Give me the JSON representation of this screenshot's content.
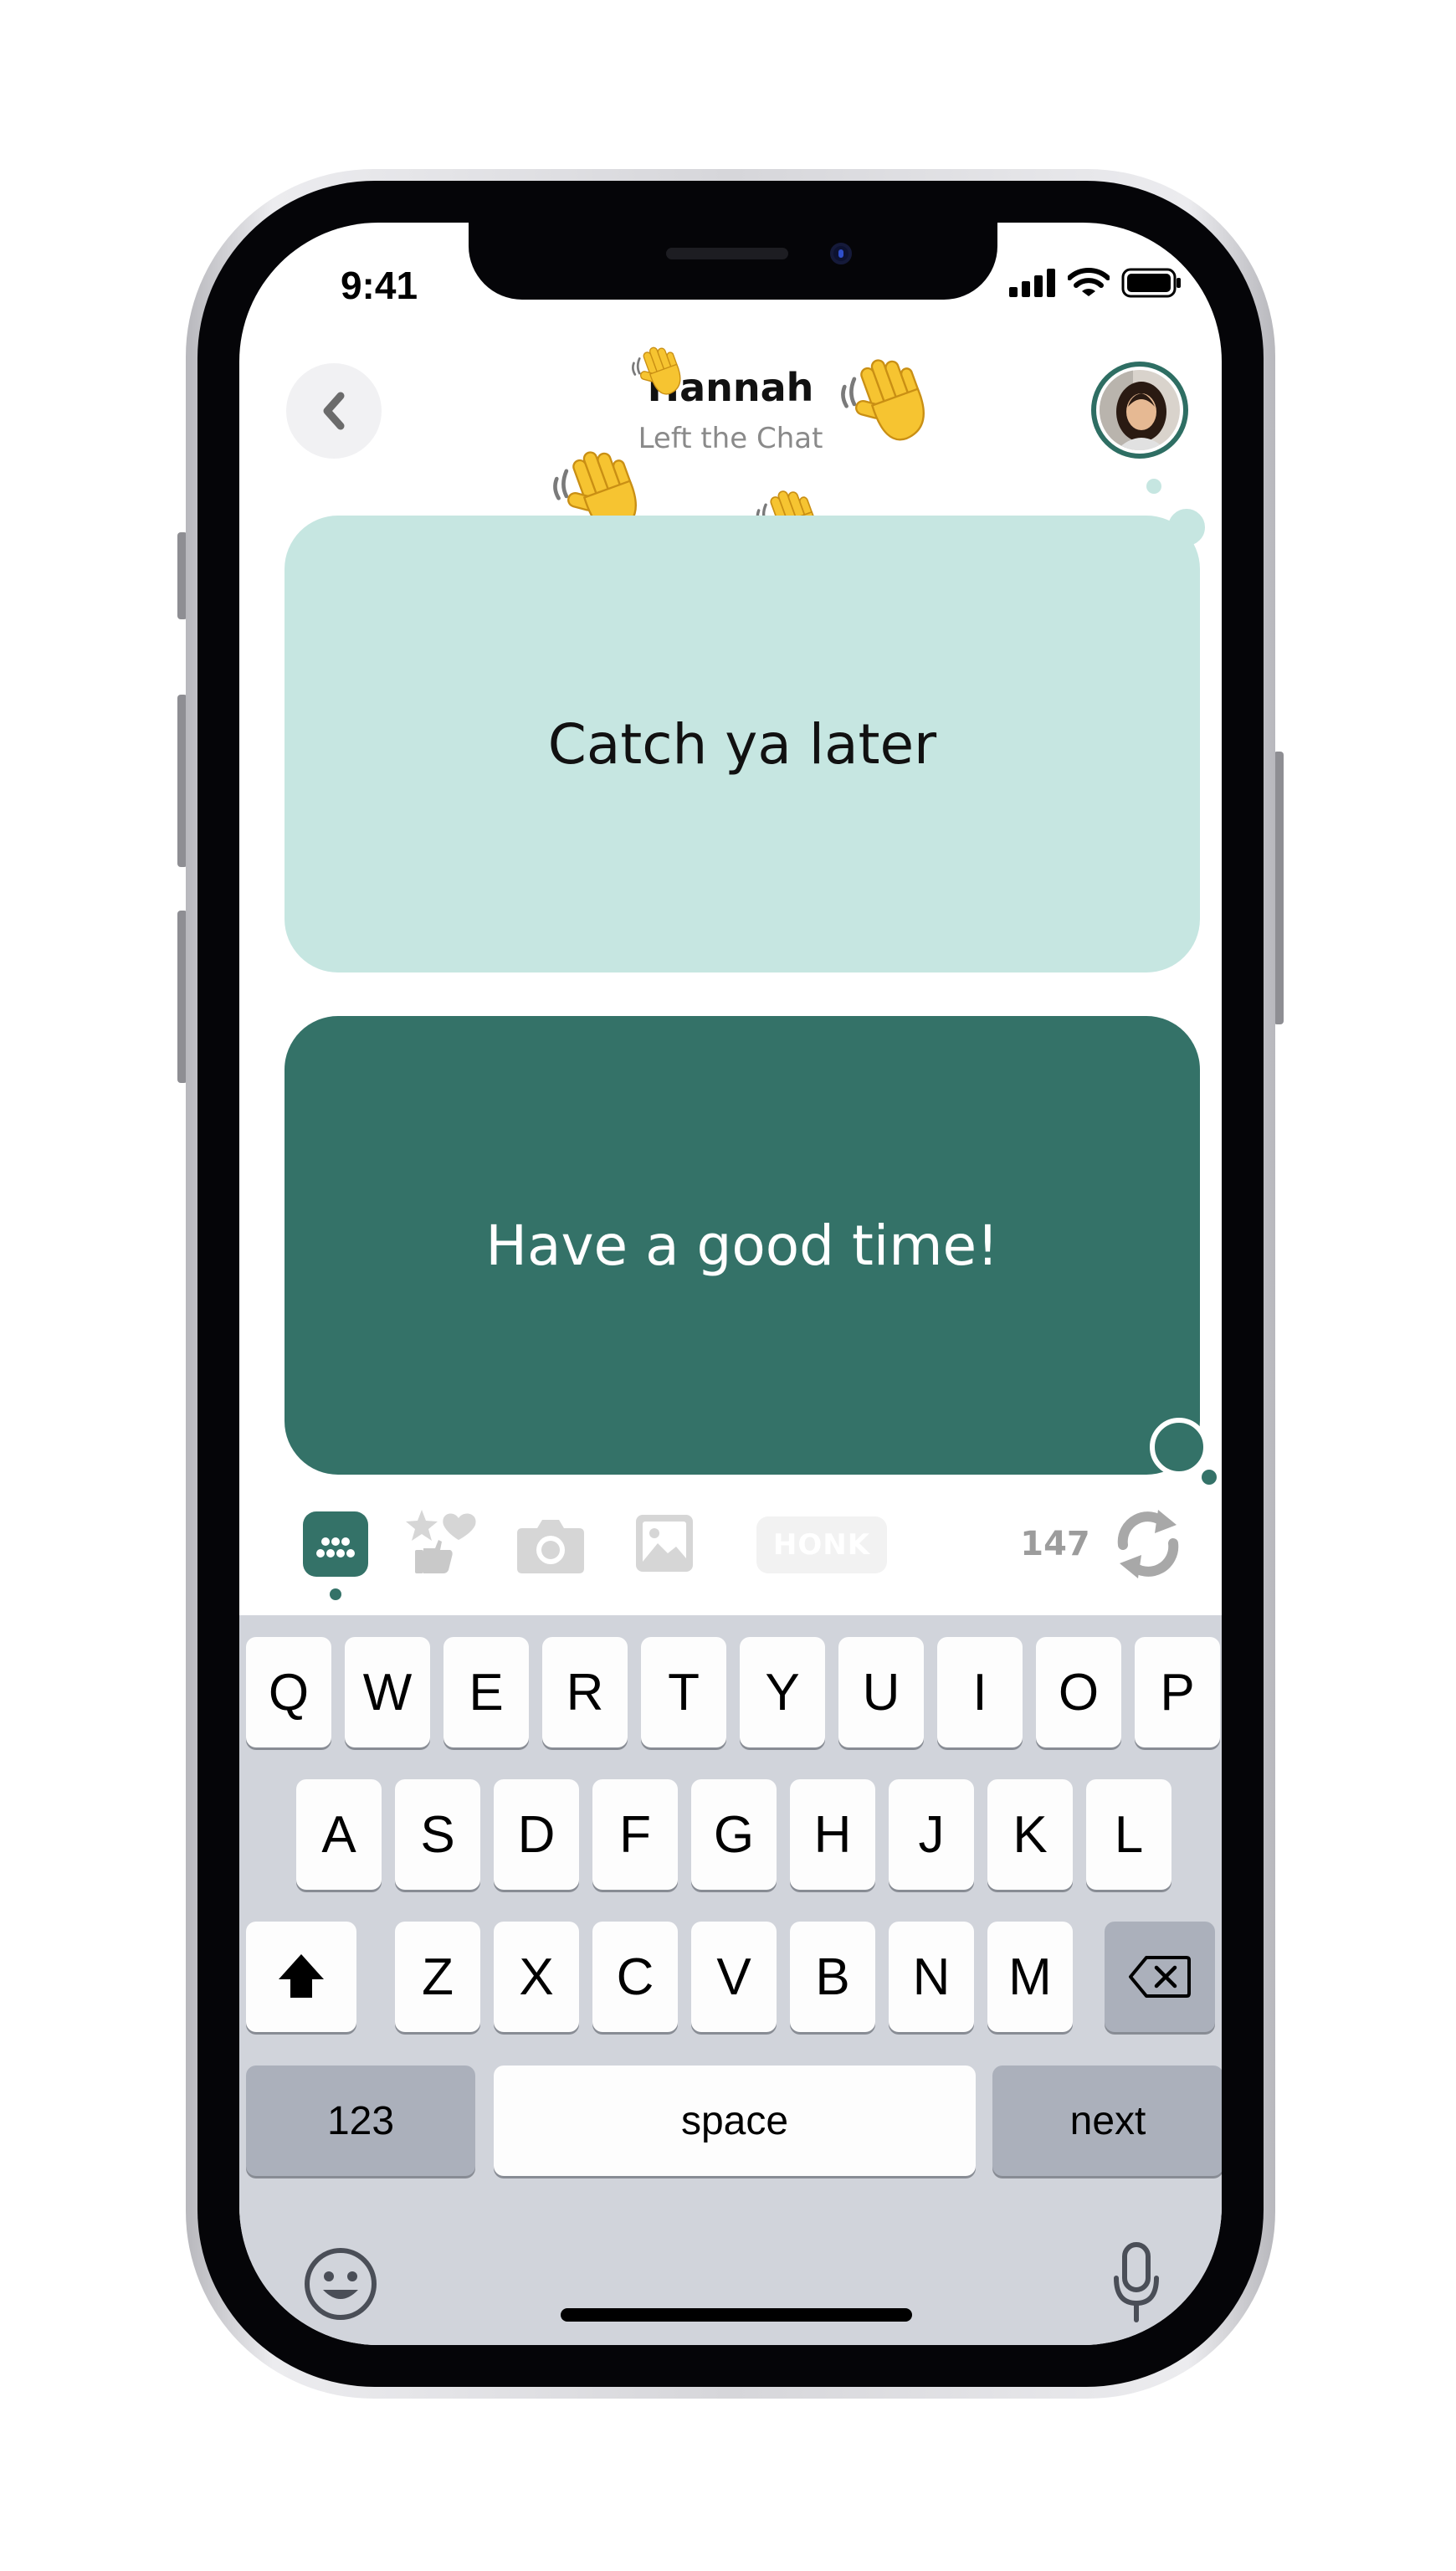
{
  "status_bar": {
    "time": "9:41"
  },
  "header": {
    "back_icon": "chevron-left-icon",
    "contact_name": "Hannah",
    "contact_status": "Left the Chat",
    "avatar_icon": "profile-photo"
  },
  "messages": [
    {
      "direction": "received",
      "text": "Catch ya later",
      "color": "#c6e6e1"
    },
    {
      "direction": "sent",
      "text": "Have a good time!",
      "color": "#347268"
    }
  ],
  "composer": {
    "tools": [
      "keyboard-icon",
      "stickers-icon",
      "camera-icon",
      "photo-icon"
    ],
    "honk_label": "HONK",
    "char_count": "147",
    "refresh_icon": "refresh-icon",
    "accent_color": "#347268"
  },
  "keyboard": {
    "row1": [
      "Q",
      "W",
      "E",
      "R",
      "T",
      "Y",
      "U",
      "I",
      "O",
      "P"
    ],
    "row2": [
      "A",
      "S",
      "D",
      "F",
      "G",
      "H",
      "J",
      "K",
      "L"
    ],
    "row3": [
      "Z",
      "X",
      "C",
      "V",
      "B",
      "N",
      "M"
    ],
    "numbers_label": "123",
    "space_label": "space",
    "next_label": "next",
    "shift_icon": "shift-icon",
    "backspace_icon": "backspace-icon",
    "emoji_icon": "emoji-icon",
    "mic_icon": "microphone-icon"
  }
}
